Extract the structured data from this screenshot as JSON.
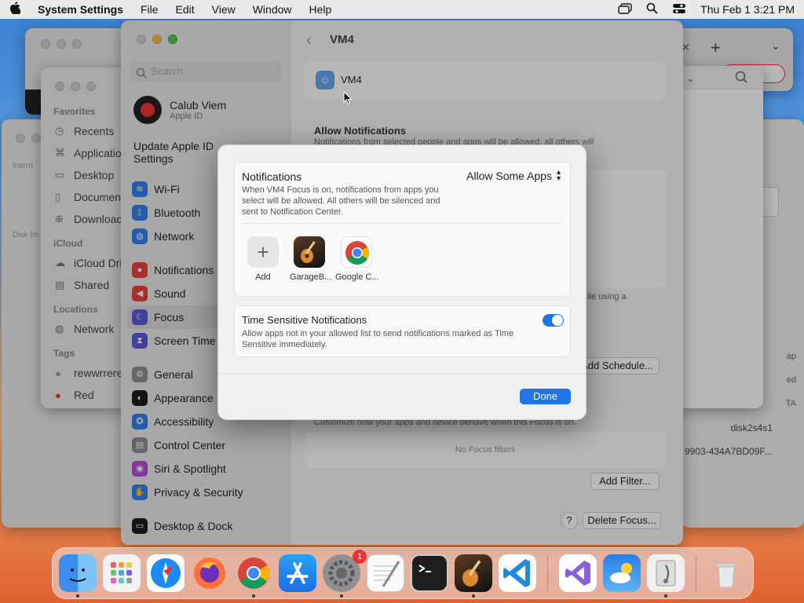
{
  "menubar": {
    "apple": "",
    "app": "System Settings",
    "items": [
      "File",
      "Edit",
      "View",
      "Window",
      "Help"
    ],
    "datetime": "Thu Feb 1  3:21 PM"
  },
  "finder": {
    "favorites": "Favorites",
    "fav_items": [
      "Recents",
      "Applications",
      "Desktop",
      "Documents",
      "Downloads"
    ],
    "icloud": "iCloud",
    "icloud_items": [
      "iCloud Drive",
      "Shared"
    ],
    "locations": "Locations",
    "loc_items": [
      "Network"
    ],
    "tags": "Tags",
    "tag_items": [
      "rewwrrere",
      "Red"
    ]
  },
  "disk_window": {
    "int_label": "Intern",
    "disk_label": "Disk Im",
    "disk_id": "disk2s4s1",
    "uuid": "9903-434A7BD09F...",
    "items": [
      "ap",
      "ed",
      "TA"
    ]
  },
  "settings": {
    "search_placeholder": "Search",
    "user_name": "Calub Viem",
    "user_sub": "Apple ID",
    "update": "Update Apple ID Settings",
    "items": [
      {
        "label": "Wi-Fi",
        "color": "#2f80ed",
        "glyph": "≋"
      },
      {
        "label": "Bluetooth",
        "color": "#2f80ed",
        "glyph": "ᛒ"
      },
      {
        "label": "Network",
        "color": "#2f80ed",
        "glyph": "◍"
      },
      {
        "label": "Notifications",
        "color": "#e8443a",
        "glyph": "●"
      },
      {
        "label": "Sound",
        "color": "#e8443a",
        "glyph": "◀"
      },
      {
        "label": "Focus",
        "color": "#5c5ad6",
        "glyph": "☾"
      },
      {
        "label": "Screen Time",
        "color": "#5c5ad6",
        "glyph": "⧗"
      },
      {
        "label": "General",
        "color": "#8e8e93",
        "glyph": "⚙"
      },
      {
        "label": "Appearance",
        "color": "#1c1c1e",
        "glyph": "◐"
      },
      {
        "label": "Accessibility",
        "color": "#2f80ed",
        "glyph": "✪"
      },
      {
        "label": "Control Center",
        "color": "#8e8e93",
        "glyph": "▤"
      },
      {
        "label": "Siri & Spotlight",
        "color": "#b44fd6",
        "glyph": "◉"
      },
      {
        "label": "Privacy & Security",
        "color": "#2f80ed",
        "glyph": "✋"
      },
      {
        "label": "Desktop & Dock",
        "color": "#1c1c1e",
        "glyph": "▭"
      }
    ],
    "title": "VM4",
    "focus_name": "VM4",
    "allow_notif": "Allow Notifications",
    "allow_notif_sub": "Notifications from selected people and apps will be allowed, all others will",
    "using_a": "ile using a",
    "add_schedule": "Add Schedule...",
    "filters_sub": "Customize how your apps and device behave when this Focus is on.",
    "no_filters": "No Focus filters",
    "add_filter": "Add Filter...",
    "help": "?",
    "delete_focus": "Delete Focus..."
  },
  "sheet": {
    "notif_title": "Notifications",
    "notif_desc": "When VM4 Focus is on, notifications from apps you select will be allowed. All others will be silenced and sent to Notification Center.",
    "popup": "Allow Some Apps",
    "apps": [
      {
        "label": "Add"
      },
      {
        "label": "GarageB..."
      },
      {
        "label": "Google C..."
      }
    ],
    "ts_title": "Time Sensitive Notifications",
    "ts_desc": "Allow apps not in your allowed list to send notifications marked as Time Sensitive immediately.",
    "ts_on": true,
    "done": "Done"
  },
  "dock": {
    "badge": "1"
  }
}
